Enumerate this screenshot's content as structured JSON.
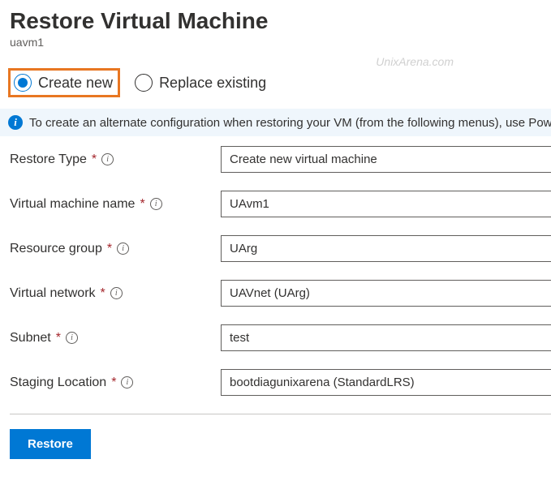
{
  "header": {
    "title": "Restore Virtual Machine",
    "subtitle": "uavm1",
    "watermark": "UnixArena.com"
  },
  "radio": {
    "create_new": "Create new",
    "replace_existing": "Replace existing"
  },
  "info_bar": "To create an alternate configuration when restoring your VM (from the following menus), use PowerShell cmdlets.",
  "form": {
    "restore_type": {
      "label": "Restore Type",
      "value": "Create new virtual machine"
    },
    "vm_name": {
      "label": "Virtual machine name",
      "value": "UAvm1"
    },
    "resource_group": {
      "label": "Resource group",
      "value": "UArg"
    },
    "virtual_network": {
      "label": "Virtual network",
      "value": "UAVnet (UArg)"
    },
    "subnet": {
      "label": "Subnet",
      "value": "test"
    },
    "staging_location": {
      "label": "Staging Location",
      "value": "bootdiagunixarena (StandardLRS)"
    }
  },
  "actions": {
    "restore": "Restore"
  }
}
